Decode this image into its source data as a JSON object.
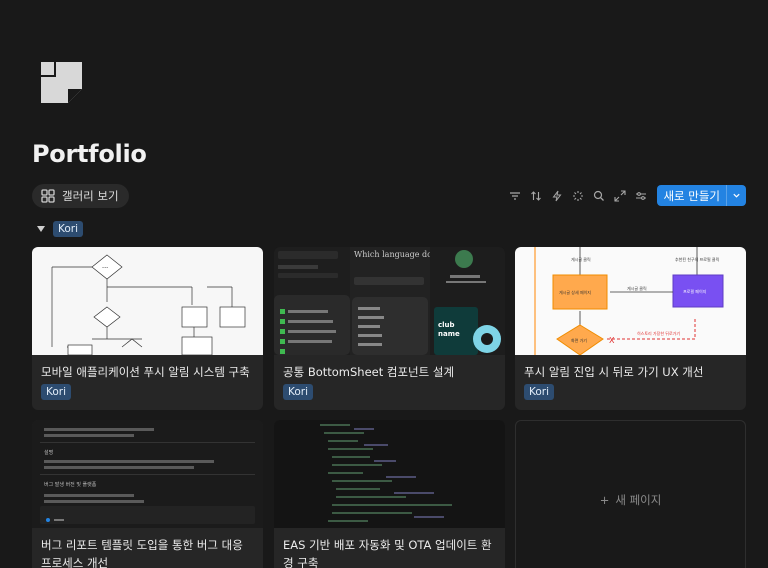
{
  "page": {
    "title": "Portfolio"
  },
  "view": {
    "tab_label": "갤러리 보기",
    "tab_icon": "grid-icon"
  },
  "toolbar": {
    "icons": [
      "filter-icon",
      "sort-icon",
      "automation-icon",
      "ai-icon",
      "search-icon",
      "expand-icon",
      "settings-icon"
    ],
    "new_label": "새로 만들기",
    "accent": "#2383e2"
  },
  "group": {
    "label": "Kori",
    "color": "#2d4c70"
  },
  "cards": [
    {
      "title": "모바일 애플리케이션 푸시 알림 시스템 구축",
      "tag": "Kori"
    },
    {
      "title": "공통 BottomSheet 컴포넌트 설계",
      "tag": "Kori"
    },
    {
      "title": "푸시 알림 진입 시 뒤로 가기 UX 개선",
      "tag": "Kori"
    },
    {
      "title": "버그 리포트 템플릿 도입을 통한 버그 대응 프로세스 개선",
      "tag": ""
    },
    {
      "title": "EAS 기반 배포 자동화 및 OTA 업데이트 환경 구축",
      "tag": ""
    }
  ],
  "thumbs": {
    "sheet_heading": "Which language do you speak?",
    "club_label": "club name",
    "flow_labels": [
      "게시글 클릭",
      "추천된 친구의 프로필 클릭",
      "게시글 상세 페이지",
      "게시글 클릭",
      "프로필 페이지",
      "화면 가기",
      "히스토리 가장한 뒤로가기"
    ],
    "bug_heading": "설명",
    "bug_sub": "버그 발생 버전 및 플랫폼"
  },
  "new_page": {
    "label": "새 페이지"
  }
}
